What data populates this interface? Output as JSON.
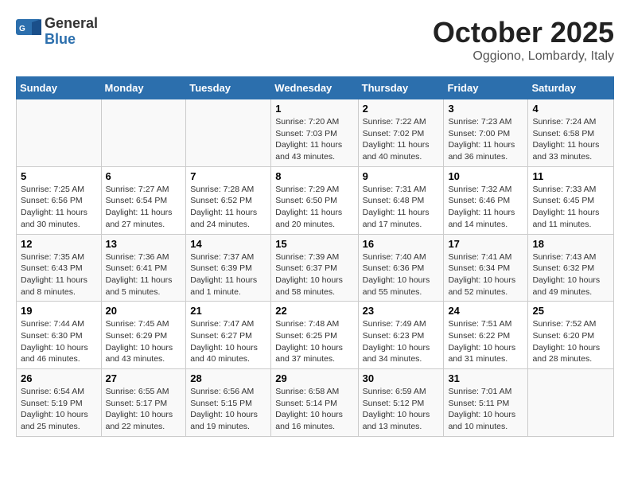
{
  "header": {
    "logo_general": "General",
    "logo_blue": "Blue",
    "month_title": "October 2025",
    "subtitle": "Oggiono, Lombardy, Italy"
  },
  "days_of_week": [
    "Sunday",
    "Monday",
    "Tuesday",
    "Wednesday",
    "Thursday",
    "Friday",
    "Saturday"
  ],
  "weeks": [
    [
      {
        "day": "",
        "info": ""
      },
      {
        "day": "",
        "info": ""
      },
      {
        "day": "",
        "info": ""
      },
      {
        "day": "1",
        "info": "Sunrise: 7:20 AM\nSunset: 7:03 PM\nDaylight: 11 hours and 43 minutes."
      },
      {
        "day": "2",
        "info": "Sunrise: 7:22 AM\nSunset: 7:02 PM\nDaylight: 11 hours and 40 minutes."
      },
      {
        "day": "3",
        "info": "Sunrise: 7:23 AM\nSunset: 7:00 PM\nDaylight: 11 hours and 36 minutes."
      },
      {
        "day": "4",
        "info": "Sunrise: 7:24 AM\nSunset: 6:58 PM\nDaylight: 11 hours and 33 minutes."
      }
    ],
    [
      {
        "day": "5",
        "info": "Sunrise: 7:25 AM\nSunset: 6:56 PM\nDaylight: 11 hours and 30 minutes."
      },
      {
        "day": "6",
        "info": "Sunrise: 7:27 AM\nSunset: 6:54 PM\nDaylight: 11 hours and 27 minutes."
      },
      {
        "day": "7",
        "info": "Sunrise: 7:28 AM\nSunset: 6:52 PM\nDaylight: 11 hours and 24 minutes."
      },
      {
        "day": "8",
        "info": "Sunrise: 7:29 AM\nSunset: 6:50 PM\nDaylight: 11 hours and 20 minutes."
      },
      {
        "day": "9",
        "info": "Sunrise: 7:31 AM\nSunset: 6:48 PM\nDaylight: 11 hours and 17 minutes."
      },
      {
        "day": "10",
        "info": "Sunrise: 7:32 AM\nSunset: 6:46 PM\nDaylight: 11 hours and 14 minutes."
      },
      {
        "day": "11",
        "info": "Sunrise: 7:33 AM\nSunset: 6:45 PM\nDaylight: 11 hours and 11 minutes."
      }
    ],
    [
      {
        "day": "12",
        "info": "Sunrise: 7:35 AM\nSunset: 6:43 PM\nDaylight: 11 hours and 8 minutes."
      },
      {
        "day": "13",
        "info": "Sunrise: 7:36 AM\nSunset: 6:41 PM\nDaylight: 11 hours and 5 minutes."
      },
      {
        "day": "14",
        "info": "Sunrise: 7:37 AM\nSunset: 6:39 PM\nDaylight: 11 hours and 1 minute."
      },
      {
        "day": "15",
        "info": "Sunrise: 7:39 AM\nSunset: 6:37 PM\nDaylight: 10 hours and 58 minutes."
      },
      {
        "day": "16",
        "info": "Sunrise: 7:40 AM\nSunset: 6:36 PM\nDaylight: 10 hours and 55 minutes."
      },
      {
        "day": "17",
        "info": "Sunrise: 7:41 AM\nSunset: 6:34 PM\nDaylight: 10 hours and 52 minutes."
      },
      {
        "day": "18",
        "info": "Sunrise: 7:43 AM\nSunset: 6:32 PM\nDaylight: 10 hours and 49 minutes."
      }
    ],
    [
      {
        "day": "19",
        "info": "Sunrise: 7:44 AM\nSunset: 6:30 PM\nDaylight: 10 hours and 46 minutes."
      },
      {
        "day": "20",
        "info": "Sunrise: 7:45 AM\nSunset: 6:29 PM\nDaylight: 10 hours and 43 minutes."
      },
      {
        "day": "21",
        "info": "Sunrise: 7:47 AM\nSunset: 6:27 PM\nDaylight: 10 hours and 40 minutes."
      },
      {
        "day": "22",
        "info": "Sunrise: 7:48 AM\nSunset: 6:25 PM\nDaylight: 10 hours and 37 minutes."
      },
      {
        "day": "23",
        "info": "Sunrise: 7:49 AM\nSunset: 6:23 PM\nDaylight: 10 hours and 34 minutes."
      },
      {
        "day": "24",
        "info": "Sunrise: 7:51 AM\nSunset: 6:22 PM\nDaylight: 10 hours and 31 minutes."
      },
      {
        "day": "25",
        "info": "Sunrise: 7:52 AM\nSunset: 6:20 PM\nDaylight: 10 hours and 28 minutes."
      }
    ],
    [
      {
        "day": "26",
        "info": "Sunrise: 6:54 AM\nSunset: 5:19 PM\nDaylight: 10 hours and 25 minutes."
      },
      {
        "day": "27",
        "info": "Sunrise: 6:55 AM\nSunset: 5:17 PM\nDaylight: 10 hours and 22 minutes."
      },
      {
        "day": "28",
        "info": "Sunrise: 6:56 AM\nSunset: 5:15 PM\nDaylight: 10 hours and 19 minutes."
      },
      {
        "day": "29",
        "info": "Sunrise: 6:58 AM\nSunset: 5:14 PM\nDaylight: 10 hours and 16 minutes."
      },
      {
        "day": "30",
        "info": "Sunrise: 6:59 AM\nSunset: 5:12 PM\nDaylight: 10 hours and 13 minutes."
      },
      {
        "day": "31",
        "info": "Sunrise: 7:01 AM\nSunset: 5:11 PM\nDaylight: 10 hours and 10 minutes."
      },
      {
        "day": "",
        "info": ""
      }
    ]
  ]
}
